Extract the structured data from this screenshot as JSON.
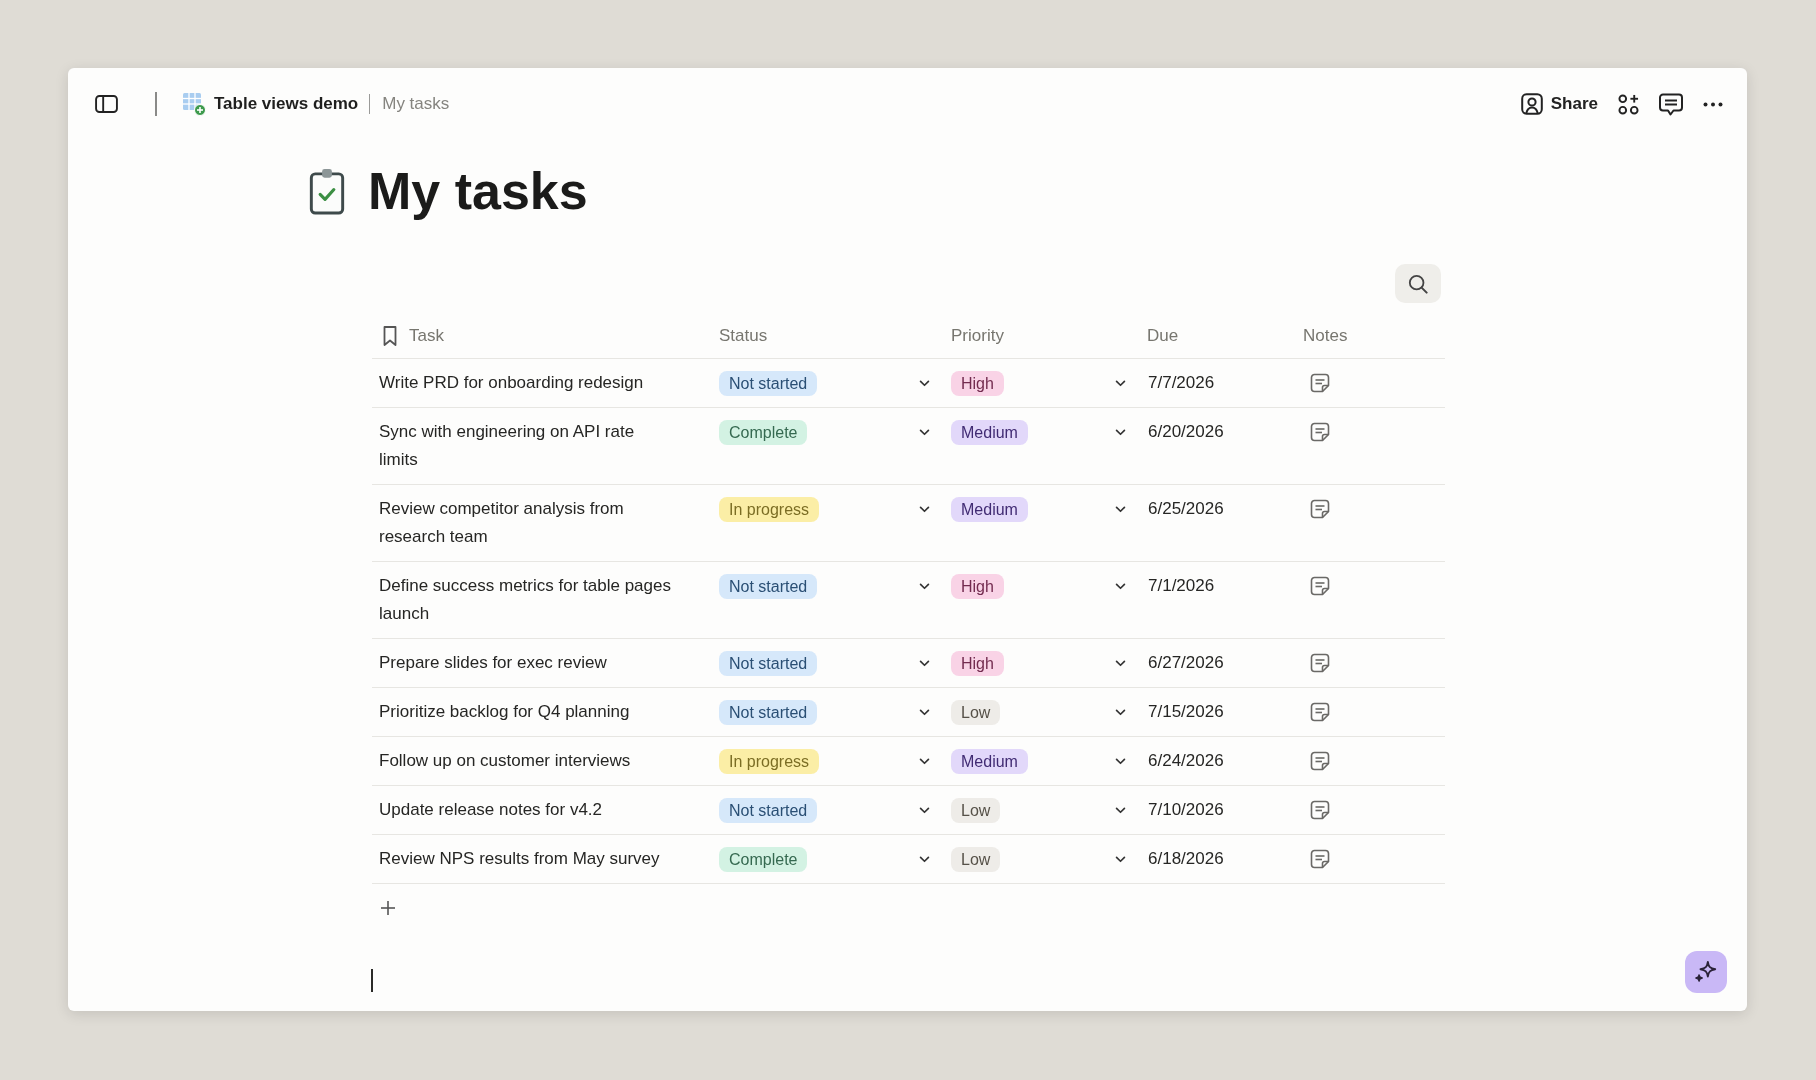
{
  "topbar": {
    "breadcrumb": {
      "workspace": "Table views demo",
      "page": "My tasks"
    },
    "share_label": "Share"
  },
  "page": {
    "title": "My tasks"
  },
  "table": {
    "columns": [
      {
        "label": "Task"
      },
      {
        "label": "Status"
      },
      {
        "label": "Priority"
      },
      {
        "label": "Due"
      },
      {
        "label": "Notes"
      }
    ],
    "rows": [
      {
        "task": "Write PRD for onboarding redesign",
        "status": {
          "label": "Not started",
          "color": "#d6e8fa"
        },
        "priority": {
          "label": "High",
          "color": "#f9d3e6"
        },
        "due": "7/7/2026"
      },
      {
        "task": "Sync with engineering on API rate limits",
        "status": {
          "label": "Complete",
          "color": "#d3f2e3"
        },
        "priority": {
          "label": "Medium",
          "color": "#e2d8fa"
        },
        "due": "6/20/2026"
      },
      {
        "task": "Review competitor analysis from research team",
        "status": {
          "label": "In progress",
          "color": "#fbeea6"
        },
        "priority": {
          "label": "Medium",
          "color": "#e2d8fa"
        },
        "due": "6/25/2026"
      },
      {
        "task": "Define success metrics for table pages launch",
        "status": {
          "label": "Not started",
          "color": "#d6e8fa"
        },
        "priority": {
          "label": "High",
          "color": "#f9d3e6"
        },
        "due": "7/1/2026"
      },
      {
        "task": "Prepare slides for exec review",
        "status": {
          "label": "Not started",
          "color": "#d6e8fa"
        },
        "priority": {
          "label": "High",
          "color": "#f9d3e6"
        },
        "due": "6/27/2026"
      },
      {
        "task": "Prioritize backlog for Q4 planning",
        "status": {
          "label": "Not started",
          "color": "#d6e8fa"
        },
        "priority": {
          "label": "Low",
          "color": "#eeece8"
        },
        "due": "7/15/2026"
      },
      {
        "task": "Follow up on customer interviews",
        "status": {
          "label": "In progress",
          "color": "#fbeea6"
        },
        "priority": {
          "label": "Medium",
          "color": "#e2d8fa"
        },
        "due": "6/24/2026"
      },
      {
        "task": "Update release notes for v4.2",
        "status": {
          "label": "Not started",
          "color": "#d6e8fa"
        },
        "priority": {
          "label": "Low",
          "color": "#eeece8"
        },
        "due": "7/10/2026"
      },
      {
        "task": "Review NPS results from May survey",
        "status": {
          "label": "Complete",
          "color": "#d3f2e3"
        },
        "priority": {
          "label": "Low",
          "color": "#eeece8"
        },
        "due": "6/18/2026"
      }
    ]
  }
}
